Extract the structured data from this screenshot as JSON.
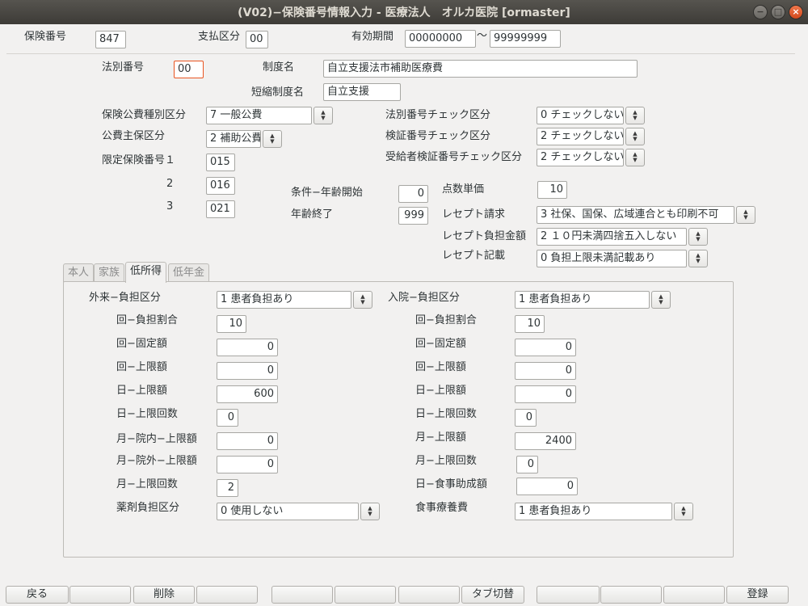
{
  "window": {
    "title": "(V02)−保険番号情報入力 - 医療法人　オルカ医院 [ormaster]",
    "buttons": [
      "−",
      "□",
      "×"
    ]
  },
  "header": {
    "insurance_number_label": "保険番号",
    "insurance_number": "847",
    "payment_class_label": "支払区分",
    "payment_class": "00",
    "valid_period_label": "有効期間",
    "valid_from": "00000000",
    "tilde": "〜",
    "valid_to": "99999999"
  },
  "form": {
    "law_number_label": "法別番号",
    "law_number": "00",
    "system_name_label": "制度名",
    "system_name": "自立支援法市補助医療費",
    "short_name_label": "短縮制度名",
    "short_name": "自立支援",
    "public_type_label": "保険公費種別区分",
    "public_type": "7 一般公費",
    "public_main_label": "公費主保区分",
    "public_main": "2 補助公費",
    "limited_label": "限定保険番号１",
    "limited_1": "015",
    "limited_2_label": "2",
    "limited_2": "016",
    "limited_3_label": "3",
    "limited_3": "021",
    "law_check_label": "法別番号チェック区分",
    "law_check": "0 チェックしない",
    "verify_check_label": "検証番号チェック区分",
    "verify_check": "2 チェックしない",
    "recipient_check_label": "受給者検証番号チェック区分",
    "recipient_check": "2 チェックしない",
    "age_start_label": "条件−年齢開始",
    "age_start": "0",
    "age_end_label": "年齢終了",
    "age_end": "999",
    "point_unit_label": "点数単価",
    "point_unit": "10",
    "receipt_claim_label": "レセプト請求",
    "receipt_claim": "3 社保、国保、広域連合とも印刷不可",
    "receipt_burden_label": "レセプト負担金額",
    "receipt_burden": "2 １０円未満四捨五入しない",
    "receipt_record_label": "レセプト記載",
    "receipt_record": "0 負担上限未満記載あり"
  },
  "tabs": [
    "本人",
    "家族",
    "低所得",
    "低年金"
  ],
  "panel": {
    "outpatient": {
      "burden_class_label": "外来−負担区分",
      "burden_class": "1 患者負担あり",
      "rows": [
        {
          "label": "回−負担割合",
          "value": "10"
        },
        {
          "label": "回−固定額",
          "value": "0"
        },
        {
          "label": "回−上限額",
          "value": "0"
        },
        {
          "label": "日−上限額",
          "value": "600"
        },
        {
          "label": "日−上限回数",
          "value": "0"
        },
        {
          "label": "月−院内−上限額",
          "value": "0"
        },
        {
          "label": "月−院外−上限額",
          "value": "0"
        },
        {
          "label": "月−上限回数",
          "value": "2"
        }
      ],
      "drug_class_label": "薬剤負担区分",
      "drug_class": "0 使用しない"
    },
    "inpatient": {
      "burden_class_label": "入院−負担区分",
      "burden_class": "1 患者負担あり",
      "rows": [
        {
          "label": "回−負担割合",
          "value": "10"
        },
        {
          "label": "回−固定額",
          "value": "0"
        },
        {
          "label": "回−上限額",
          "value": "0"
        },
        {
          "label": "日−上限額",
          "value": "0"
        },
        {
          "label": "日−上限回数",
          "value": "0"
        },
        {
          "label": "月−上限額",
          "value": "2400"
        },
        {
          "label": "月−上限回数",
          "value": "0"
        },
        {
          "label": "日−食事助成額",
          "value": "0"
        }
      ],
      "meal_label": "食事療養費",
      "meal": "1 患者負担あり"
    }
  },
  "footer": [
    "戻る",
    "",
    "削除",
    "",
    "",
    "",
    "",
    "タブ切替",
    "",
    "",
    "",
    "登録"
  ]
}
